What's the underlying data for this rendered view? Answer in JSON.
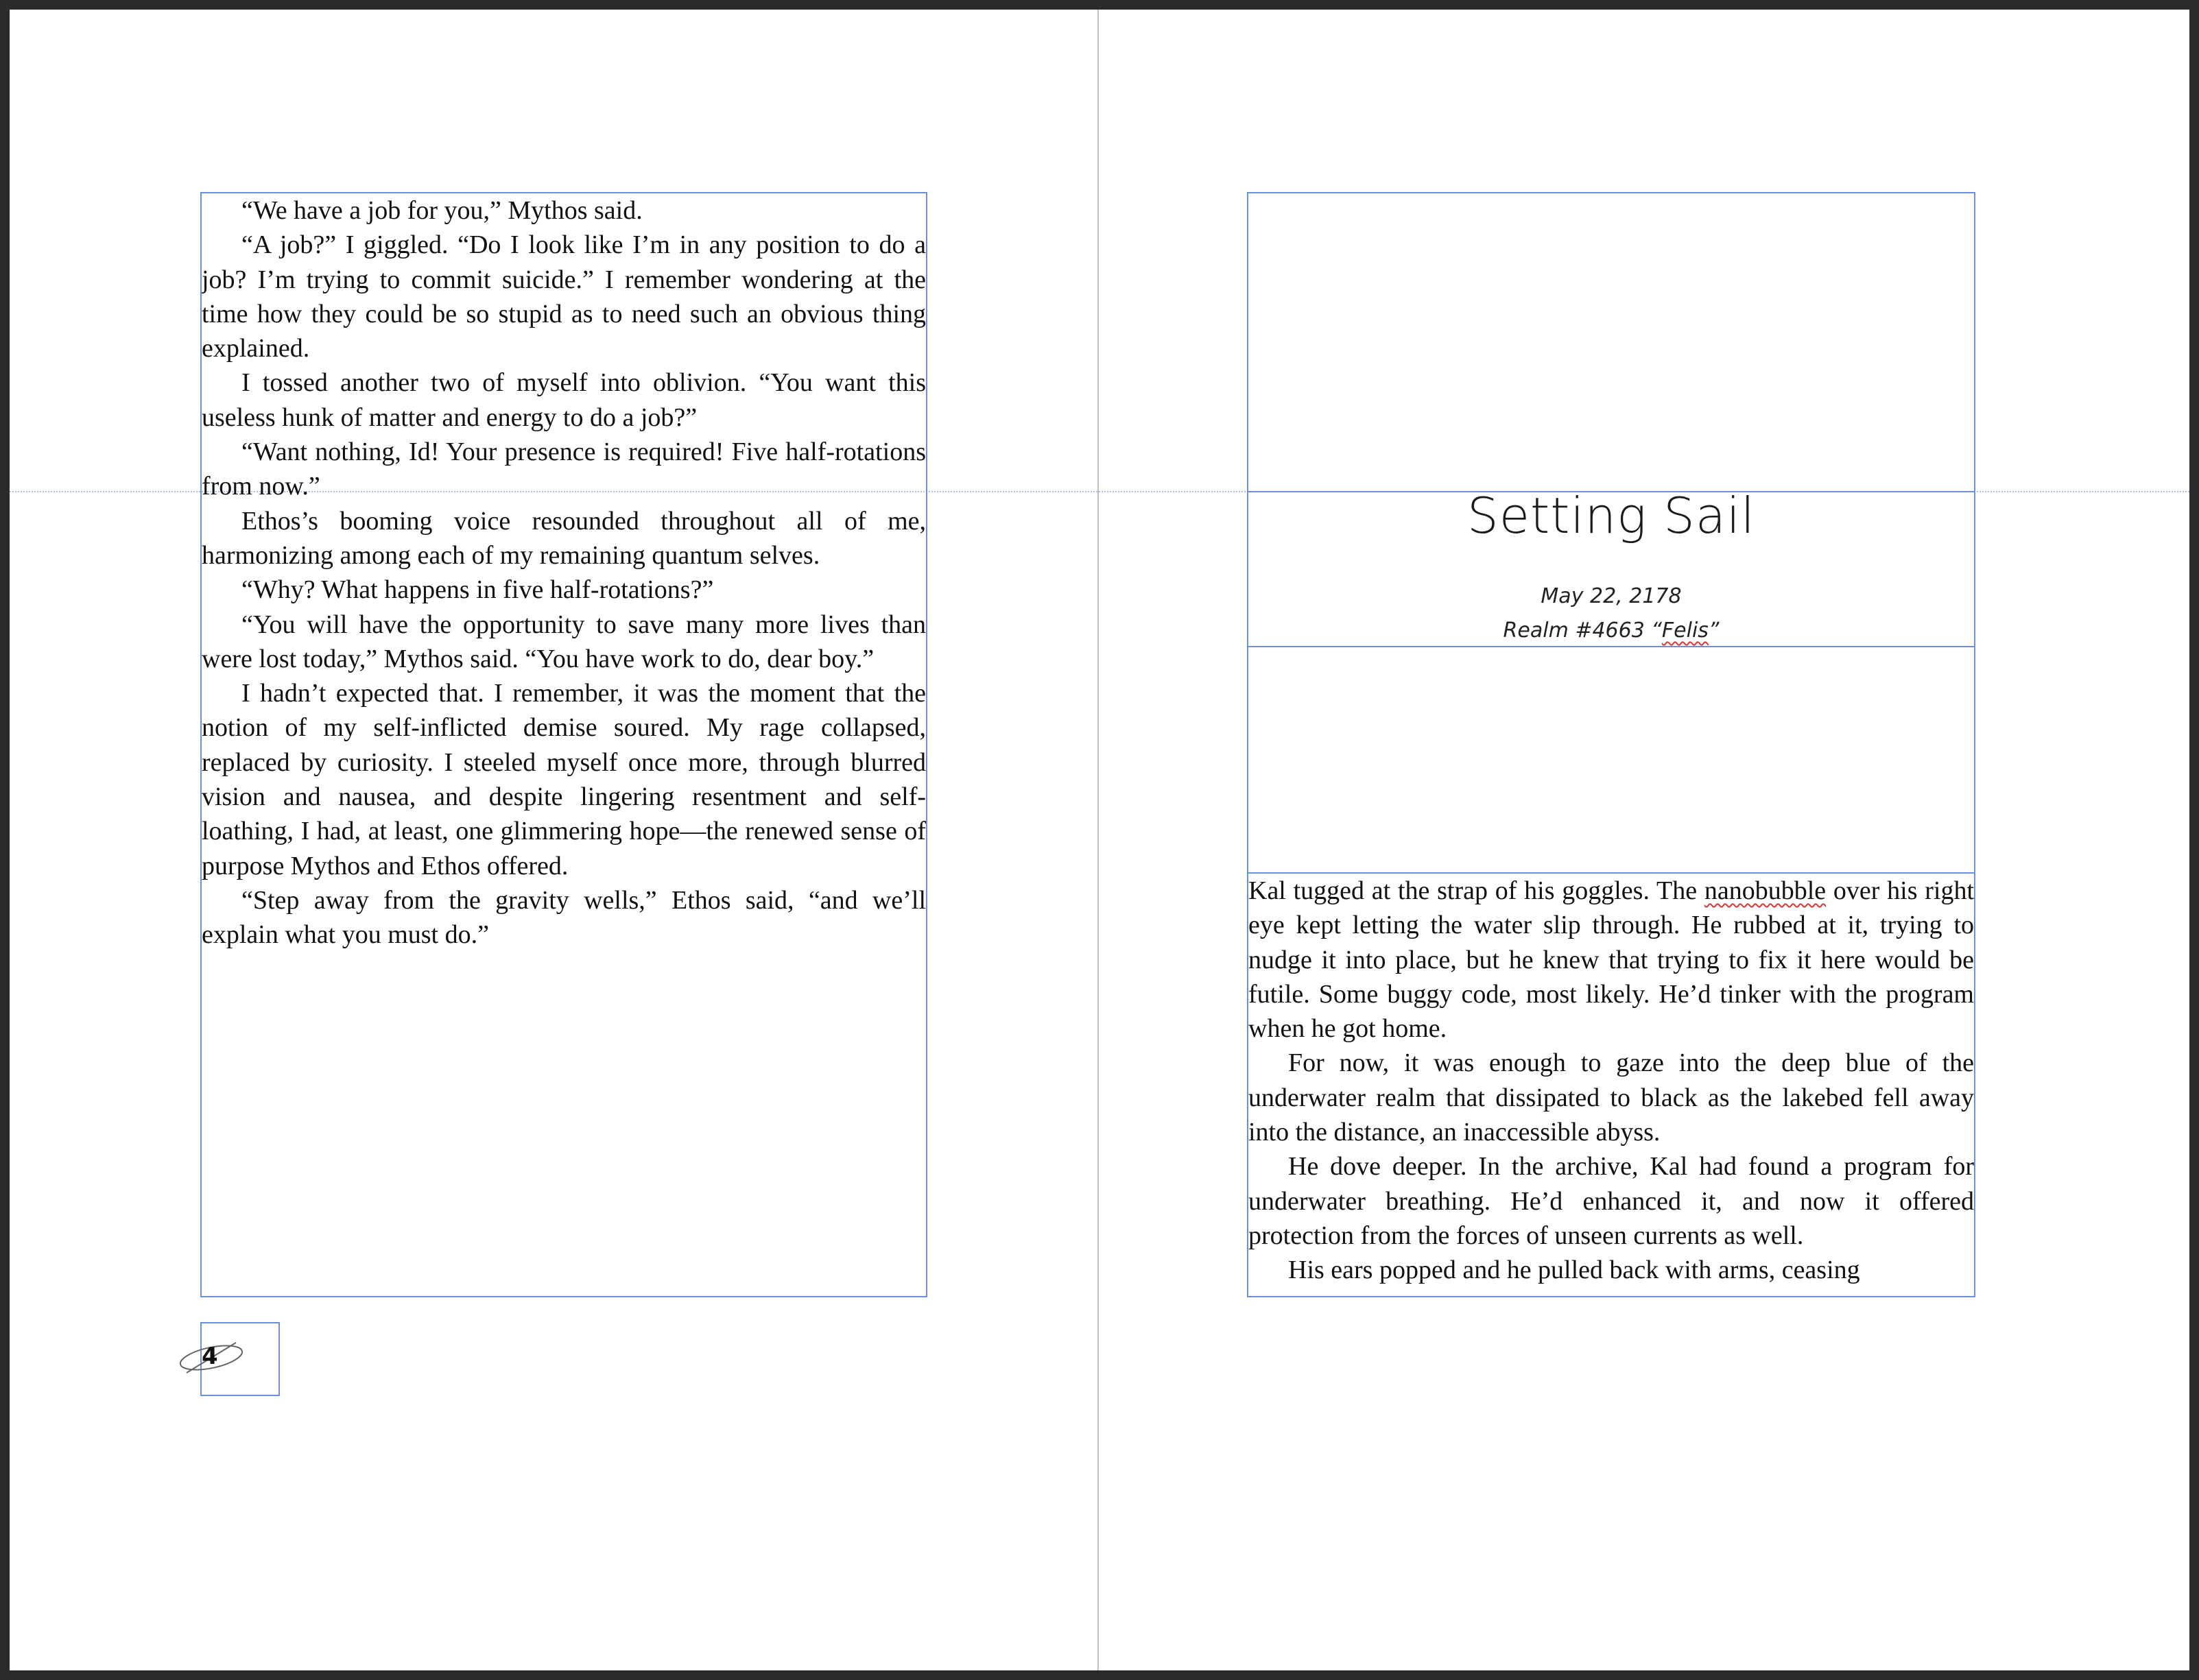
{
  "left_page": {
    "paragraphs": [
      "“We have a job for you,” Mythos said.",
      "“A job?” I giggled. “Do I look like I’m in any position to do a job? I’m trying to commit suicide.” I remember wondering at the time how they could be so stupid as to need such an obvious thing explained.",
      "I tossed another two of myself into oblivion. “You want this useless hunk of matter and energy to do a job?”",
      "“Want nothing, Id! Your presence is required! Five half-rotations from now.”",
      "Ethos’s booming voice resounded throughout all of me, harmonizing among each of my remaining quantum selves.",
      "“Why? What happens in five half-rotations?”",
      "“You will have the opportunity to save many more lives than were lost today,” Mythos said. “You have work to do, dear boy.”",
      "I hadn’t expected that. I remember, it was the moment that the notion of my self-inflicted demise soured. My rage collapsed, replaced by curiosity. I steeled myself once more, through blurred vision and nausea, and despite lingering resentment and self-loathing, I had, at least, one glimmering hope—the renewed sense of purpose Mythos and Ethos offered.",
      "“Step away from the gravity wells,” Ethos said, “and we’ll explain what you must do.”"
    ],
    "page_number": "4"
  },
  "right_page": {
    "chapter_title": "Setting Sail",
    "date": "May 22, 2178",
    "realm_prefix": "Realm #4663 “",
    "realm_name": "Felis",
    "realm_suffix": "”",
    "p1_a": "Kal tugged at the strap of his goggles. The ",
    "p1_flagged": "nanobubble",
    "p1_b": " over his right eye kept letting the water slip through. He rubbed at it, trying to nudge it into place, but he knew that trying to fix it here would be futile. Some buggy code, most likely. He’d tinker with the program when he got home.",
    "paragraphs": [
      "For now, it was enough to gaze into the deep blue of the underwater realm that dissipated to black as the lakebed fell away into the distance, an inaccessible abyss.",
      "He dove deeper. In the archive, Kal had found a program for underwater breathing. He’d enhanced it, and now it offered protection from the forces of unseen currents as well.",
      "His ears popped and he pulled back with arms, ceasing"
    ]
  }
}
